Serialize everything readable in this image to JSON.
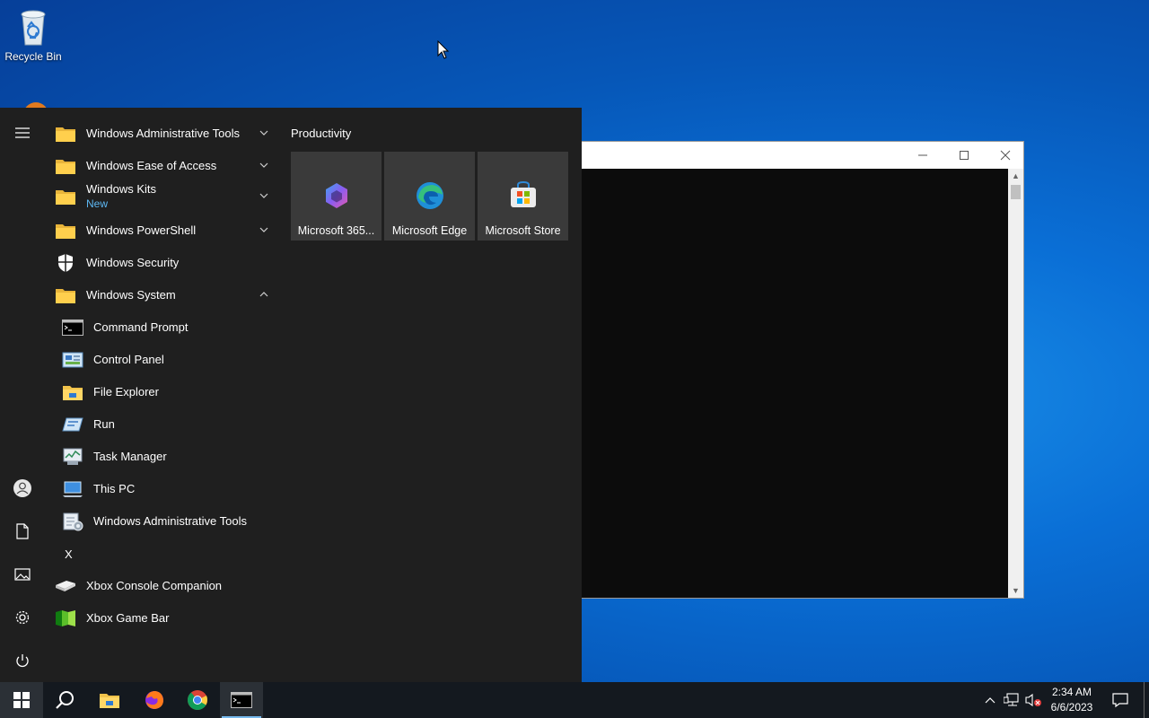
{
  "desktop": {
    "recycle_bin_label": "Recycle Bin"
  },
  "start_menu": {
    "apps": [
      {
        "label": "Windows Administrative Tools",
        "icon": "folder-icon",
        "expand": "down"
      },
      {
        "label": "Windows Ease of Access",
        "icon": "folder-icon",
        "expand": "down"
      },
      {
        "label": "Windows Kits",
        "sublabel": "New",
        "icon": "folder-icon",
        "expand": "down"
      },
      {
        "label": "Windows PowerShell",
        "icon": "folder-icon",
        "expand": "down"
      },
      {
        "label": "Windows Security",
        "icon": "shield-icon"
      },
      {
        "label": "Windows System",
        "icon": "folder-icon",
        "expand": "up"
      },
      {
        "label": "Command Prompt",
        "icon": "command-prompt-icon"
      },
      {
        "label": "Control Panel",
        "icon": "control-panel-icon"
      },
      {
        "label": "File Explorer",
        "icon": "file-explorer-icon"
      },
      {
        "label": "Run",
        "icon": "run-icon"
      },
      {
        "label": "Task Manager",
        "icon": "task-manager-icon"
      },
      {
        "label": "This PC",
        "icon": "this-pc-icon"
      },
      {
        "label": "Windows Administrative Tools",
        "icon": "admin-tools-icon"
      },
      {
        "label": "Xbox Console Companion",
        "icon": "xbox-console-icon"
      },
      {
        "label": "Xbox Game Bar",
        "icon": "xbox-game-bar-icon"
      }
    ],
    "letter_x": "X",
    "tile_group": "Productivity",
    "tiles": [
      {
        "label": "Microsoft 365...",
        "icon": "microsoft-365-icon"
      },
      {
        "label": "Microsoft Edge",
        "icon": "edge-icon"
      },
      {
        "label": "Microsoft Store",
        "icon": "store-icon"
      }
    ]
  },
  "taskbar": {
    "time": "2:34 AM",
    "date": "6/6/2023"
  },
  "colors": {
    "start_bg": "#1f1f1f",
    "tile_bg": "#3a3a3a",
    "taskbar_bg": "#14191f",
    "accent": "#76b9ed",
    "new_tag": "#5db8f3"
  }
}
